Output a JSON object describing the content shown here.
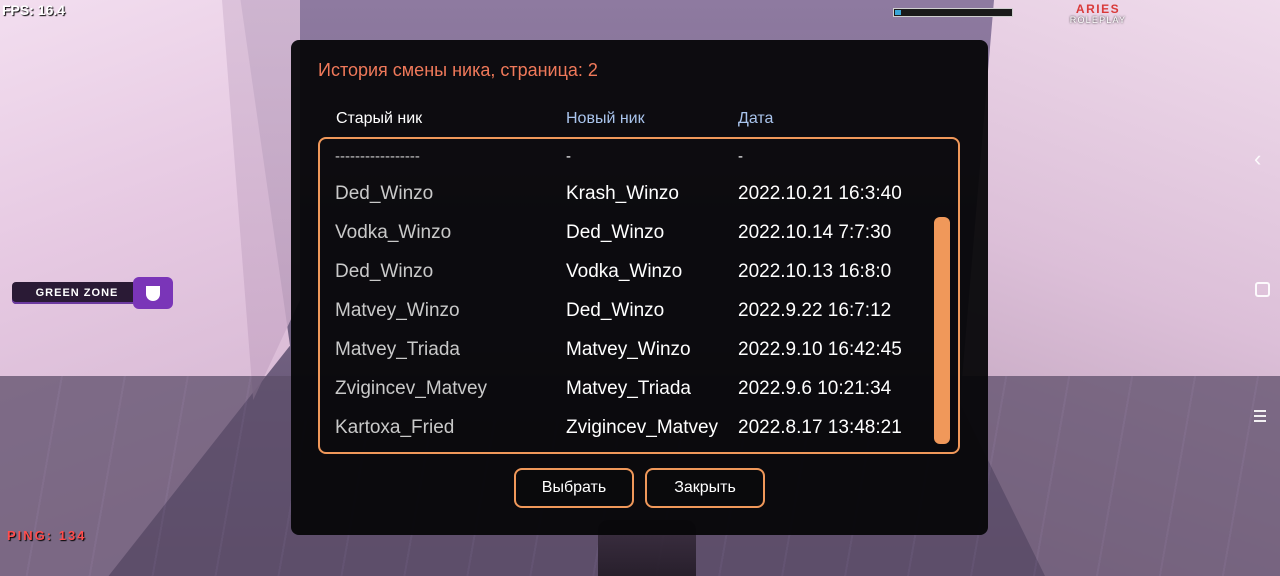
{
  "hud": {
    "fps": "FPS: 16.4",
    "health_fraction": 0.05,
    "logo_top": "ARIES",
    "logo_bottom": "ROLEPLAY",
    "ping": "PING: 134",
    "zone_label": "GREEN ZONE"
  },
  "dialog": {
    "title": "История смены ника, страница: 2",
    "columns": {
      "old": "Старый ник",
      "new": "Новый ник",
      "date": "Дата"
    },
    "rows": [
      {
        "old": "-----------------",
        "new": "-",
        "date": "-"
      },
      {
        "old": "Ded_Winzo",
        "new": "Krash_Winzo",
        "date": "2022.10.21 16:3:40"
      },
      {
        "old": "Vodka_Winzo",
        "new": "Ded_Winzo",
        "date": "2022.10.14 7:7:30"
      },
      {
        "old": "Ded_Winzo",
        "new": "Vodka_Winzo",
        "date": "2022.10.13 16:8:0"
      },
      {
        "old": "Matvey_Winzo",
        "new": "Ded_Winzo",
        "date": "2022.9.22 16:7:12"
      },
      {
        "old": "Matvey_Triada",
        "new": "Matvey_Winzo",
        "date": "2022.9.10 16:42:45"
      },
      {
        "old": "Zvigincev_Matvey",
        "new": "Matvey_Triada",
        "date": "2022.9.6 10:21:34"
      },
      {
        "old": "Kartoxa_Fried",
        "new": "Zvigincev_Matvey",
        "date": "2022.8.17 13:48:21"
      }
    ],
    "buttons": {
      "select": "Выбрать",
      "close": "Закрыть"
    }
  },
  "colors": {
    "accent": "#f0985a",
    "title": "#f0795a",
    "column_header": "#a9c4ec"
  }
}
